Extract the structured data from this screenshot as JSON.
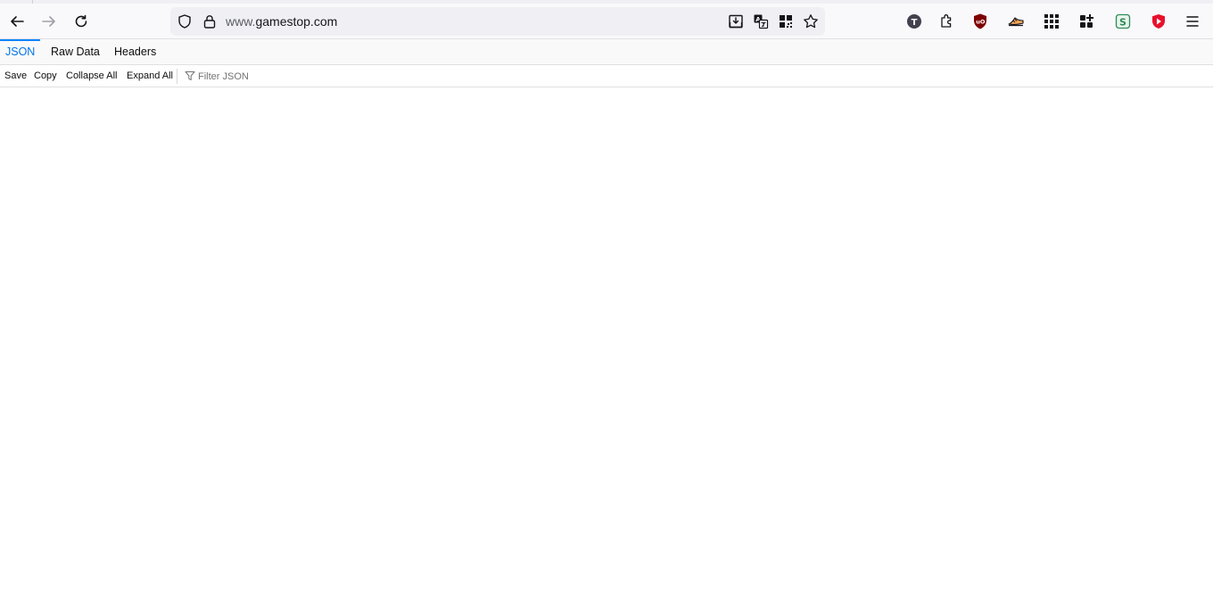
{
  "browser": {
    "url_host": "www.gamestop.com",
    "url_prefix": "www.",
    "url_domain": "gamestop.com"
  },
  "icons": {
    "back": "back-arrow-icon",
    "forward": "forward-arrow-icon",
    "reload": "reload-icon",
    "tracking": "shield-icon",
    "lock": "lock-icon",
    "download_page": "save-page-icon",
    "translate": "translate-icon",
    "qr": "qr-code-icon",
    "bookmark": "star-icon",
    "ext_t": "extension-t-icon",
    "extensions": "puzzle-icon",
    "ublock": "ublock-origin-icon",
    "ext_sneaker": "extension-shoe-icon",
    "apps_grid": "apps-grid-icon",
    "add_grid": "grid-plus-icon",
    "ext_s": "extension-s-icon",
    "youtube": "play-shield-icon",
    "menu": "hamburger-menu-icon"
  },
  "colors": {
    "accent": "#0074e8",
    "ublock": "#800000",
    "ext_s": "#2e8b57",
    "play": "#e8112d"
  },
  "json_viewer": {
    "tabs": [
      {
        "label": "JSON",
        "active": true
      },
      {
        "label": "Raw Data",
        "active": false
      },
      {
        "label": "Headers",
        "active": false
      }
    ],
    "toolbar": {
      "save": "Save",
      "copy": "Copy",
      "collapse_all": "Collapse All",
      "expand_all": "Expand All",
      "filter_placeholder": "Filter JSON"
    }
  }
}
